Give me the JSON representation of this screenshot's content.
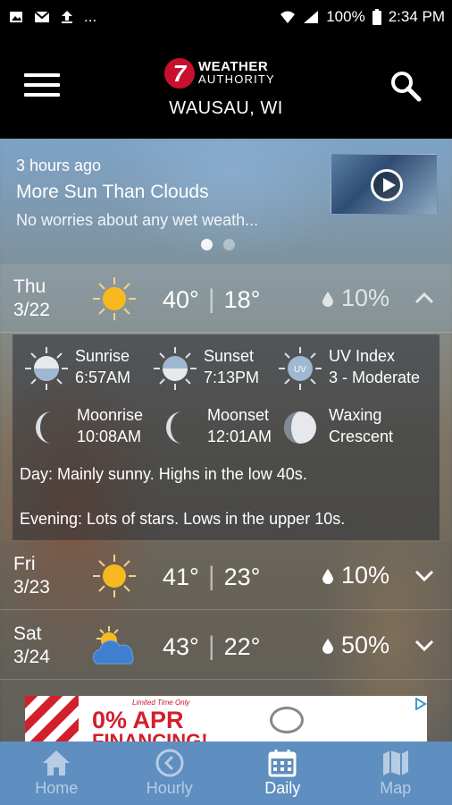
{
  "status_bar": {
    "left_icons": [
      "photo-notification-icon",
      "mail-notification-icon",
      "upload-notification-icon"
    ],
    "more": "...",
    "battery": "100%",
    "time": "2:34 PM"
  },
  "header": {
    "logo_number": "7",
    "logo_line1": "WEATHER",
    "logo_line2": "AUTHORITY",
    "location": "WAUSAU, WI"
  },
  "news": {
    "time": "3 hours ago",
    "title": "More Sun Than Clouds",
    "subtitle": "No worries about any wet weath..."
  },
  "days": [
    {
      "dow": "Thu",
      "date": "3/22",
      "icon": "sunny-icon",
      "high": "40°",
      "low": "18°",
      "precip": "10%",
      "expanded": true
    },
    {
      "dow": "Fri",
      "date": "3/23",
      "icon": "sunny-icon",
      "high": "41°",
      "low": "23°",
      "precip": "10%",
      "expanded": false
    },
    {
      "dow": "Sat",
      "date": "3/24",
      "icon": "partly-cloudy-icon",
      "high": "43°",
      "low": "22°",
      "precip": "50%",
      "expanded": false
    }
  ],
  "detail": {
    "sunrise_label": "Sunrise",
    "sunrise_value": "6:57AM",
    "sunset_label": "Sunset",
    "sunset_value": "7:13PM",
    "uv_label": "UV Index",
    "uv_value": "3 - Moderate",
    "uv_icon_text": "UV",
    "moonrise_label": "Moonrise",
    "moonrise_value": "10:08AM",
    "moonset_label": "Moonset",
    "moonset_value": "12:01AM",
    "moon_phase_line1": "Waxing",
    "moon_phase_line2": "Crescent",
    "day_desc": "Day: Mainly sunny. Highs in the low 40s.",
    "evening_desc": "Evening: Lots of stars. Lows in the upper 10s."
  },
  "ad": {
    "small": "Limited Time Only",
    "line1": "0% APR",
    "line2": "FINANCING!"
  },
  "tabs": [
    {
      "label": "Home",
      "active": false
    },
    {
      "label": "Hourly",
      "active": false
    },
    {
      "label": "Daily",
      "active": true
    },
    {
      "label": "Map",
      "active": false
    }
  ],
  "colors": {
    "tab_bar": "#5f8ec0",
    "sun": "#f7b91e",
    "brand_red": "#c8102e"
  }
}
